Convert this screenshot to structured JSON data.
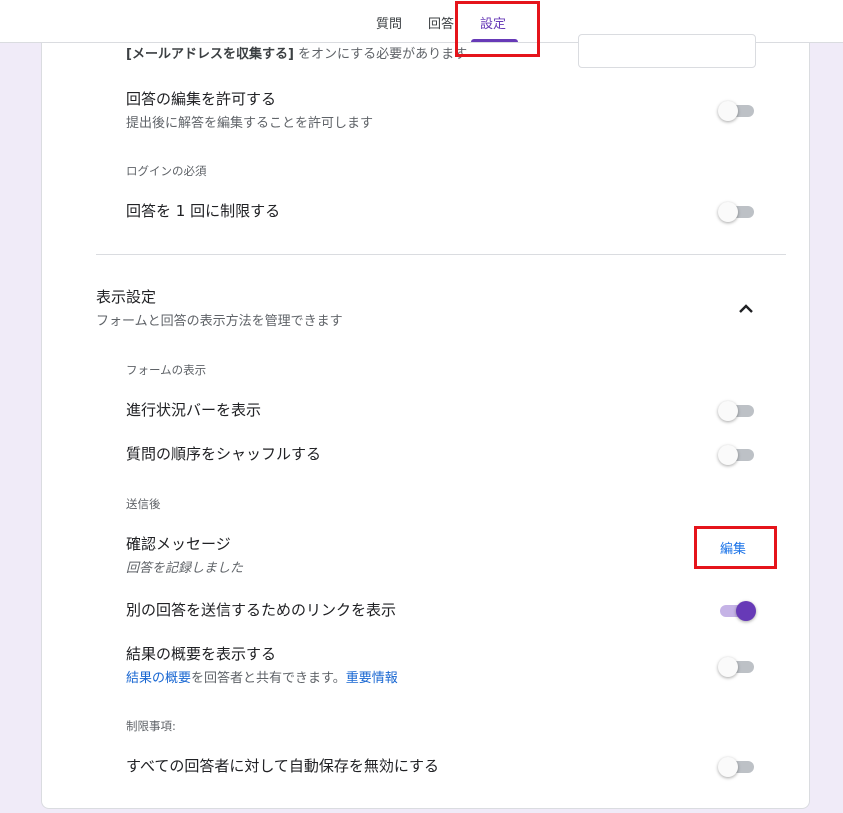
{
  "tabs": [
    {
      "label": "質問"
    },
    {
      "label": "回答"
    },
    {
      "label": "設定"
    }
  ],
  "responses_section": {
    "email_note_prefix": "[メールアドレスを収集する]",
    "email_note_suffix": " をオンにする必要があります",
    "allow_edit": {
      "title": "回答の編集を許可する",
      "subtitle": "提出後に解答を編集することを許可します",
      "enabled": false
    },
    "login_required_label": "ログインの必須",
    "limit_one": {
      "title": "回答を 1 回に制限する",
      "enabled": false
    }
  },
  "presentation": {
    "title": "表示設定",
    "subtitle": "フォームと回答の表示方法を管理できます",
    "form_display_label": "フォームの表示",
    "progress_bar": {
      "title": "進行状況バーを表示",
      "enabled": false
    },
    "shuffle": {
      "title": "質問の順序をシャッフルする",
      "enabled": false
    },
    "after_submit_label": "送信後",
    "confirmation": {
      "title": "確認メッセージ",
      "message": "回答を記録しました",
      "edit_label": "編集"
    },
    "another_link": {
      "title": "別の回答を送信するためのリンクを表示",
      "enabled": true
    },
    "summary": {
      "title": "結果の概要を表示する",
      "link_text": "結果の概要",
      "middle_text": "を回答者と共有できます。",
      "info_link": "重要情報",
      "enabled": false
    },
    "restrictions_label": "制限事項:",
    "disable_autosave": {
      "title": "すべての回答者に対して自動保存を無効にする",
      "enabled": false
    }
  },
  "colors": {
    "accent": "#673ab7",
    "link": "#1a73e8",
    "highlight": "#e5141b",
    "background": "#f0ebf8"
  }
}
